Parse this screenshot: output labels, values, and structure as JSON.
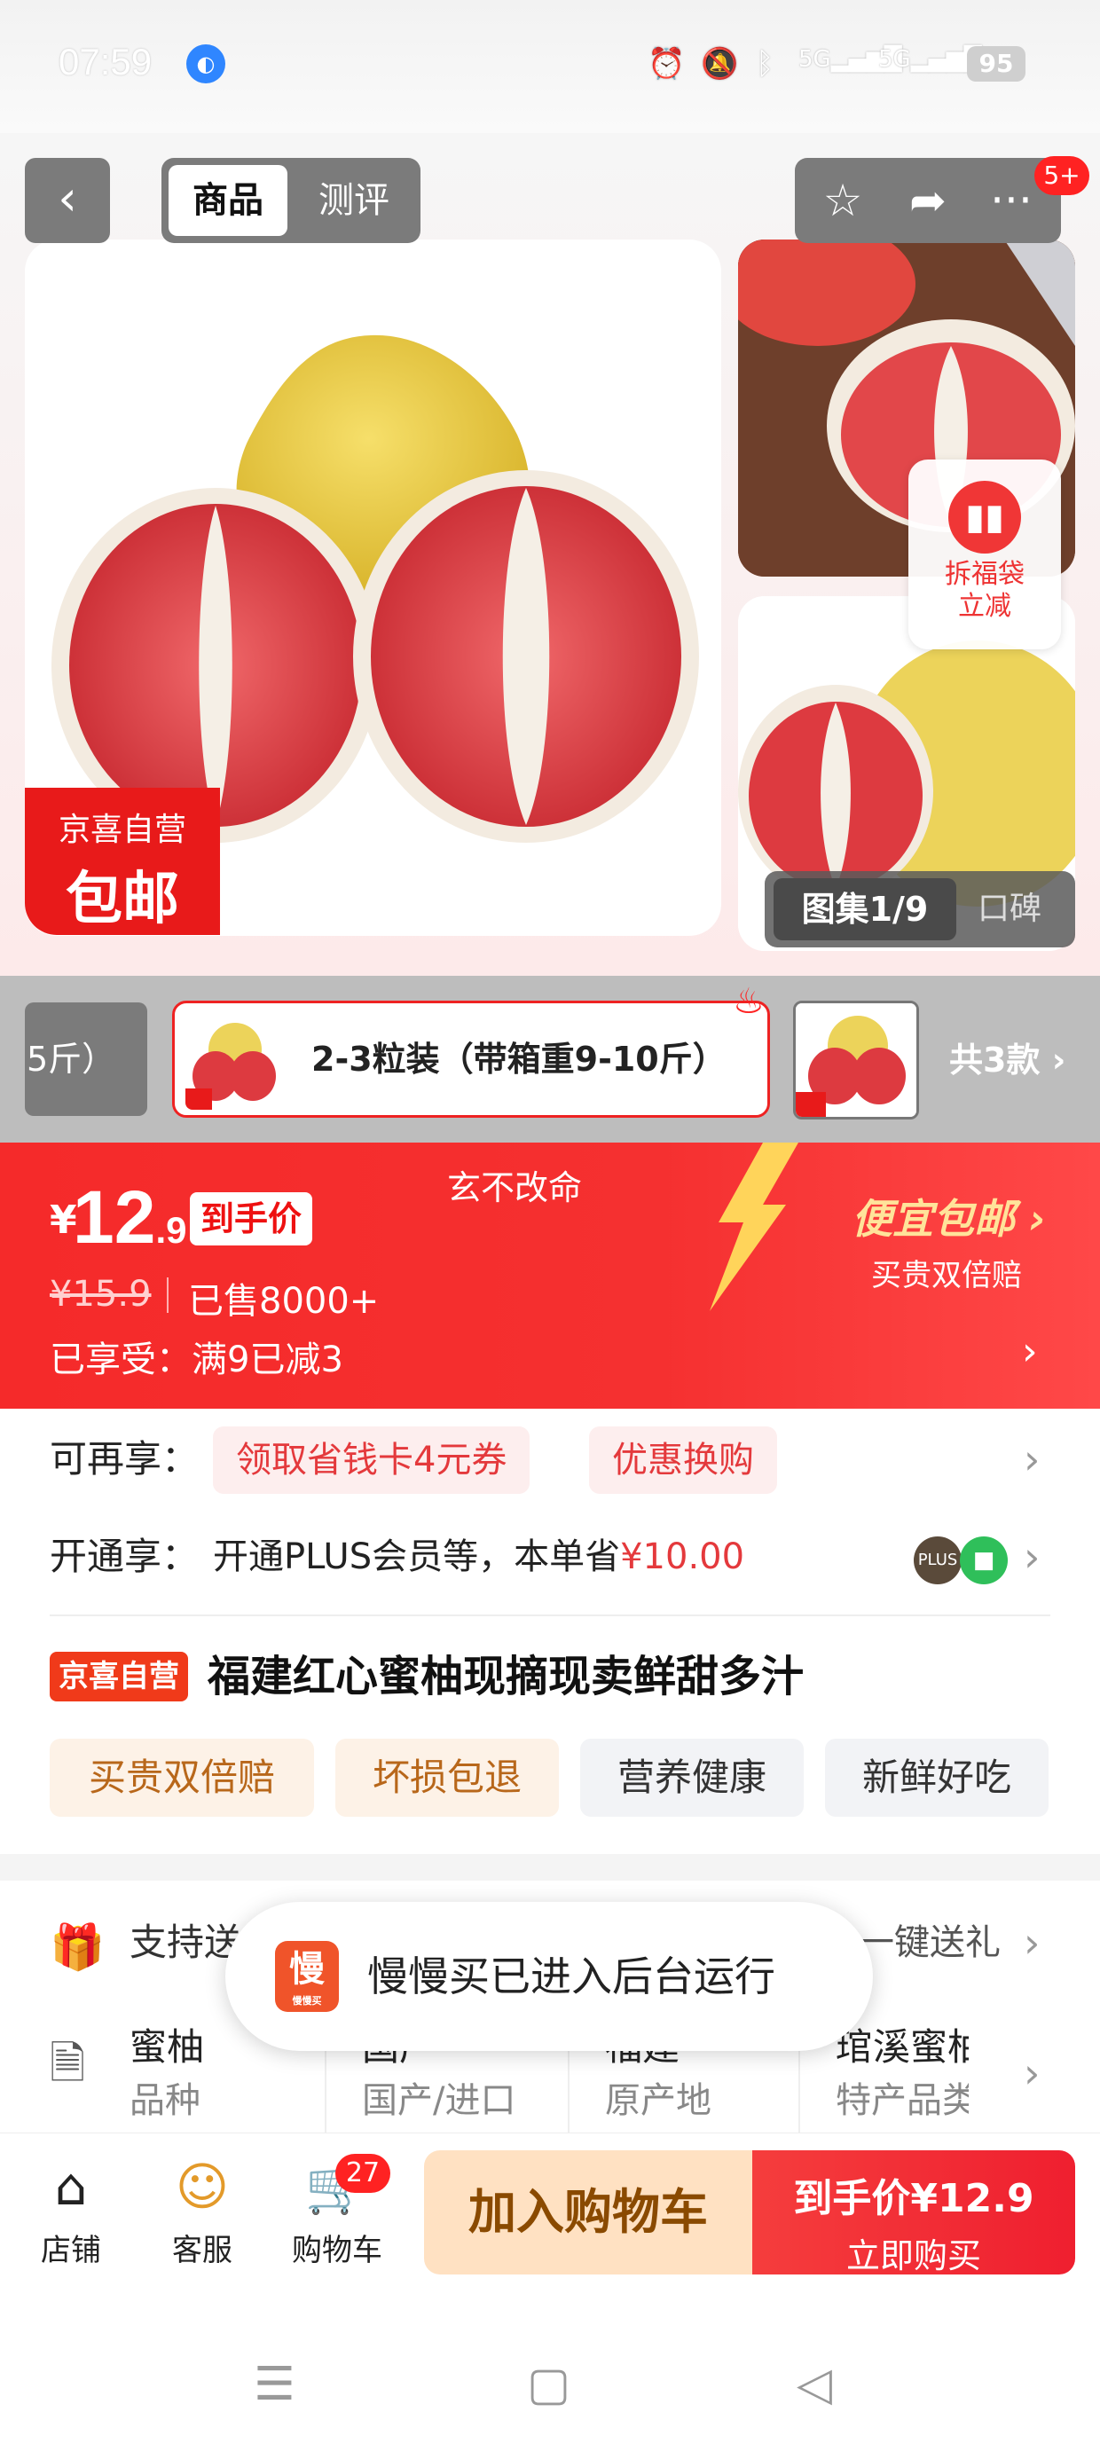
{
  "status": {
    "time": "07:59",
    "network": "5G",
    "battery": "95"
  },
  "header": {
    "tab_product": "商品",
    "tab_review": "测评",
    "badge": "5+"
  },
  "hero": {
    "tag_line1": "京喜自营",
    "tag_line2": "包邮",
    "fudai_line1": "拆福袋",
    "fudai_line2": "立减",
    "gallery_label": "图集1/9",
    "praise_label": "口碑"
  },
  "variants": {
    "prev_label": "5斤）",
    "selected_label": "2-3粒装（带箱重9-10斤）",
    "count_label": "共3款"
  },
  "price": {
    "currency": "¥",
    "main": "12",
    "decimal": ".9",
    "tag": "到手价",
    "slogan": "玄不改命",
    "original": "¥15.9",
    "sold": "已售8000+",
    "enjoyed": "已享受：满9已减3",
    "promo_title": "便宜包邮",
    "promo_sub": "买贵双倍赔"
  },
  "benefits": {
    "more_label": "可再享：",
    "coupon1": "领取省钱卡4元券",
    "coupon2": "优惠换购",
    "plus_label": "开通享：",
    "plus_text": "开通PLUS会员等，本单省",
    "plus_amount": "¥10.00"
  },
  "product": {
    "tag": "京喜自营",
    "name": "福建红心蜜柚现摘现卖鲜甜多汁",
    "chips": [
      "买贵双倍赔",
      "坏损包退",
      "营养健康",
      "新鲜好吃"
    ]
  },
  "service": {
    "label": "支持送",
    "right": "一键送礼"
  },
  "toast": {
    "app_icon_text": "慢",
    "app_icon_sub": "慢慢买",
    "text": "慢慢买已进入后台运行"
  },
  "params": [
    {
      "value": "蜜柚",
      "key": "品种"
    },
    {
      "value": "国产",
      "key": "国产/进口"
    },
    {
      "value": "福建",
      "key": "原产地"
    },
    {
      "value": "琯溪蜜柚",
      "key": "特产品类"
    }
  ],
  "bottom": {
    "shop": "店铺",
    "service": "客服",
    "cart": "购物车",
    "cart_count": "27",
    "add_cart": "加入购物车",
    "buy_line1": "到手价¥12.9",
    "buy_line2": "立即购买"
  },
  "colors": {
    "brand_red": "#f52a2a",
    "add_cart_bg": "#ffe1c2",
    "tag_red": "#e81a1a"
  }
}
